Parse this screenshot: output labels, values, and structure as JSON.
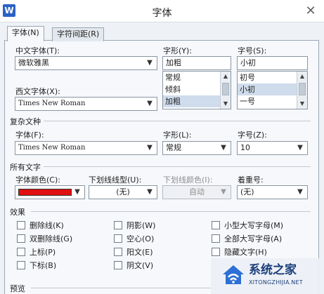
{
  "window": {
    "title": "字体",
    "app_icon": "W",
    "close_glyph": "✕"
  },
  "tabs": [
    {
      "label": "字体(N)"
    },
    {
      "label": "字符间距(R)"
    }
  ],
  "latin_font_section": {
    "cn_font_label": "中文字体(T):",
    "cn_font_value": "微软雅黑",
    "style_label": "字形(Y):",
    "style_value": "加粗",
    "style_options": [
      "常规",
      "倾斜",
      "加粗"
    ],
    "size_label": "字号(S):",
    "size_value": "小初",
    "size_options": [
      "初号",
      "小初",
      "一号"
    ],
    "west_font_label": "西文字体(X):",
    "west_font_value": "Times New Roman"
  },
  "complex_script": {
    "heading": "复杂文种",
    "font_label": "字体(F):",
    "font_value": "Times New Roman",
    "style_label": "字形(L):",
    "style_value": "常规",
    "size_label": "字号(Z):",
    "size_value": "10"
  },
  "all_text": {
    "heading": "所有文字",
    "color_label": "字体颜色(C):",
    "color_value": "#e01010",
    "underline_label": "下划线线型(U):",
    "underline_value": "(无)",
    "underline_color_label": "下划线颜色(I):",
    "underline_color_value": "自动",
    "emphasis_label": "着重号:",
    "emphasis_value": "(无)"
  },
  "effects": {
    "heading": "效果",
    "col1": [
      "删除线(K)",
      "双删除线(G)",
      "上标(P)",
      "下标(B)"
    ],
    "col2": [
      "阴影(W)",
      "空心(O)",
      "阳文(E)",
      "阴文(V)"
    ],
    "col3": [
      "小型大写字母(M)",
      "全部大写字母(A)",
      "隐藏文字(H)"
    ]
  },
  "preview": {
    "heading": "预览"
  },
  "watermark": {
    "text": "系统之家",
    "url": "XITONGZHIJIA.NET"
  }
}
